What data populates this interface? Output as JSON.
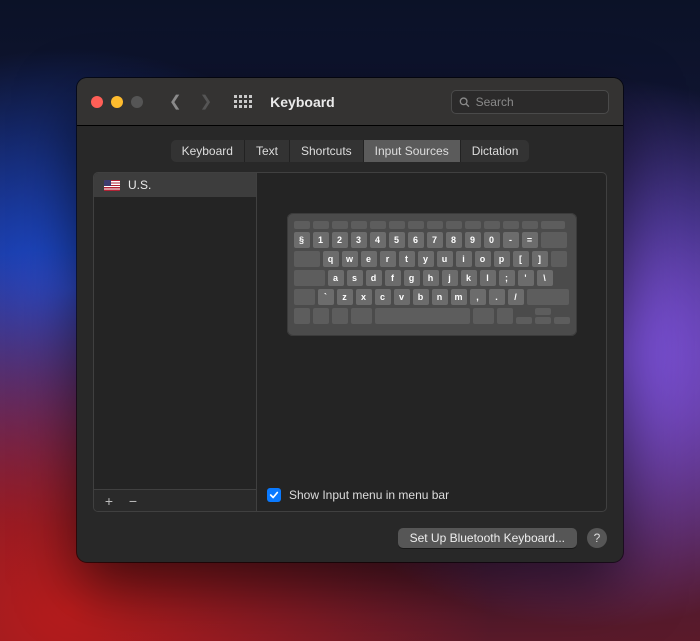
{
  "window": {
    "title": "Keyboard"
  },
  "search": {
    "placeholder": "Search"
  },
  "tabs": [
    {
      "label": "Keyboard",
      "active": false
    },
    {
      "label": "Text",
      "active": false
    },
    {
      "label": "Shortcuts",
      "active": false
    },
    {
      "label": "Input Sources",
      "active": true
    },
    {
      "label": "Dictation",
      "active": false
    }
  ],
  "sources": {
    "items": [
      {
        "label": "U.S."
      }
    ]
  },
  "keyboard_layout": {
    "row1": [
      "§",
      "1",
      "2",
      "3",
      "4",
      "5",
      "6",
      "7",
      "8",
      "9",
      "0",
      "-",
      "="
    ],
    "row2": [
      "q",
      "w",
      "e",
      "r",
      "t",
      "y",
      "u",
      "i",
      "o",
      "p",
      "[",
      "]"
    ],
    "row3": [
      "a",
      "s",
      "d",
      "f",
      "g",
      "h",
      "j",
      "k",
      "l",
      ";",
      "'",
      "\\"
    ],
    "row4": [
      "`",
      "z",
      "x",
      "c",
      "v",
      "b",
      "n",
      "m",
      ",",
      ".",
      "/"
    ]
  },
  "show_input_menu": {
    "checked": true,
    "label": "Show Input menu in menu bar"
  },
  "bluetooth_button": "Set Up Bluetooth Keyboard...",
  "help_button": "?"
}
